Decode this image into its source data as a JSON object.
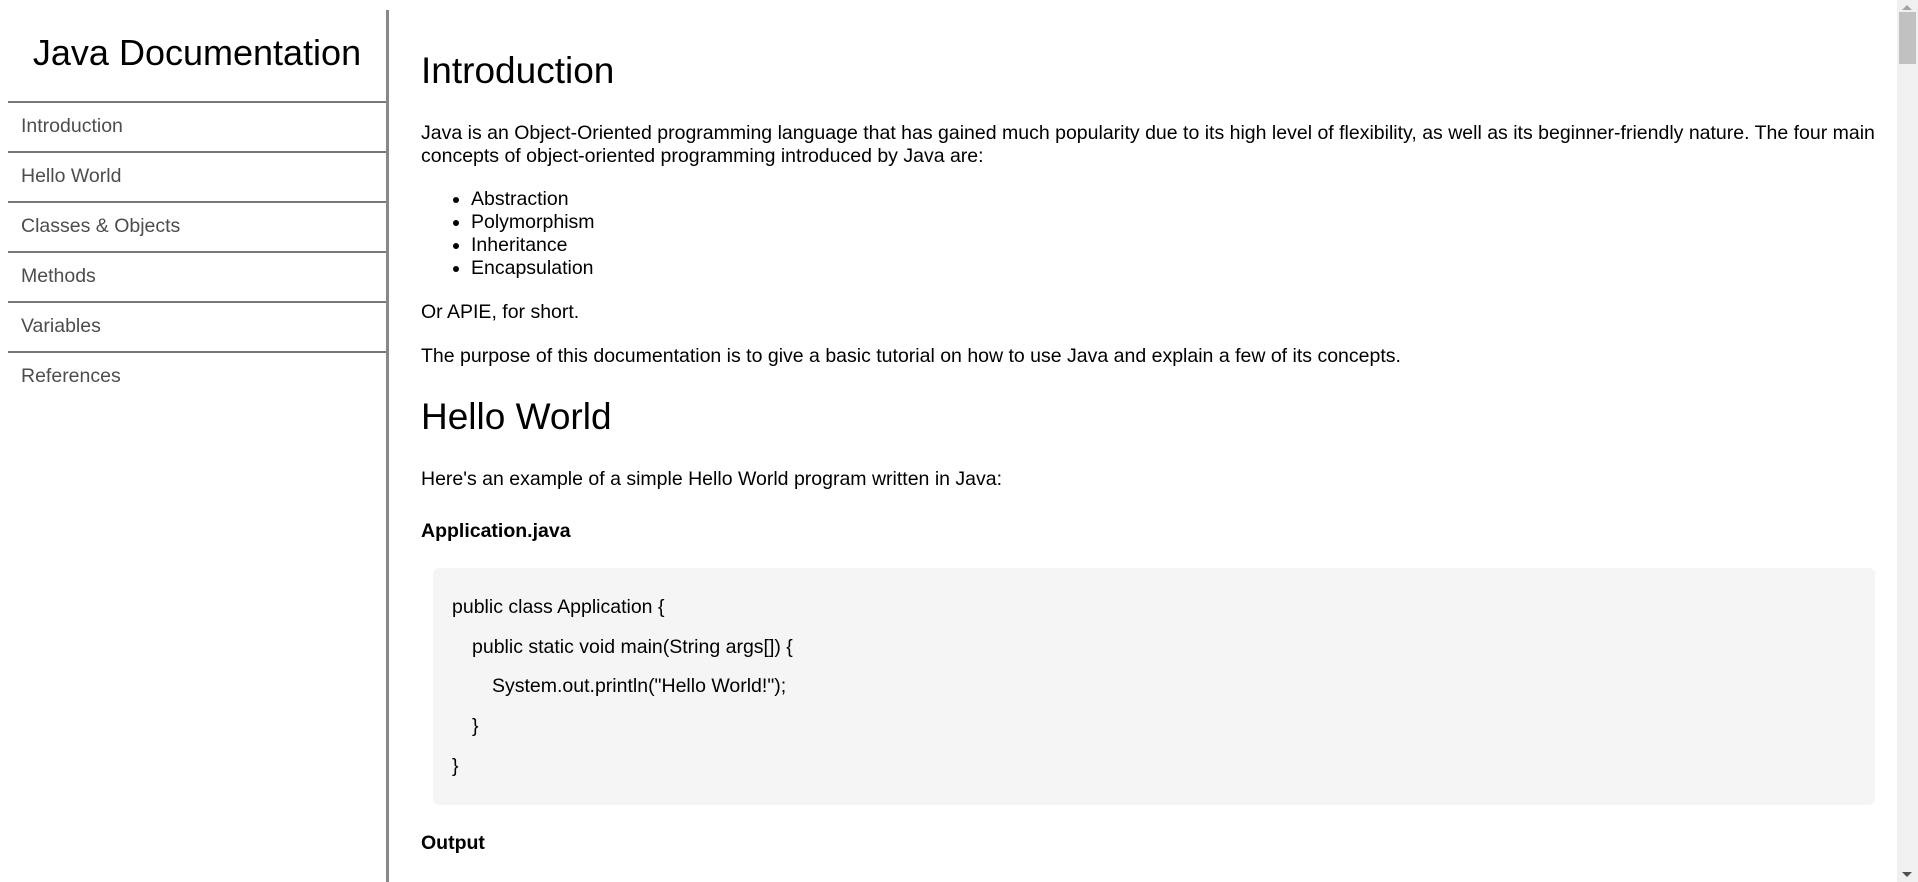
{
  "sidebar": {
    "title": "Java Documentation",
    "items": [
      {
        "label": "Introduction"
      },
      {
        "label": "Hello World"
      },
      {
        "label": "Classes & Objects"
      },
      {
        "label": "Methods"
      },
      {
        "label": "Variables"
      },
      {
        "label": "References"
      }
    ]
  },
  "main": {
    "intro": {
      "heading": "Introduction",
      "para1": "Java is an Object-Oriented programming language that has gained much popularity due to its high level of flexibility, as well as its beginner-friendly nature. The four main concepts of object-oriented programming introduced by Java are:",
      "concepts": [
        "Abstraction",
        "Polymorphism",
        "Inheritance",
        "Encapsulation"
      ],
      "para2": "Or APIE, for short.",
      "para3": "The purpose of this documentation is to give a basic tutorial on how to use Java and explain a few of its concepts."
    },
    "hello": {
      "heading": "Hello World",
      "para1": "Here's an example of a simple Hello World program written in Java:",
      "filename": "Application.java",
      "code": [
        "public class Application {",
        "public static void main(String args[]) {",
        "System.out.println(\"Hello World!\");",
        "}",
        "}"
      ],
      "output_label": "Output"
    }
  }
}
